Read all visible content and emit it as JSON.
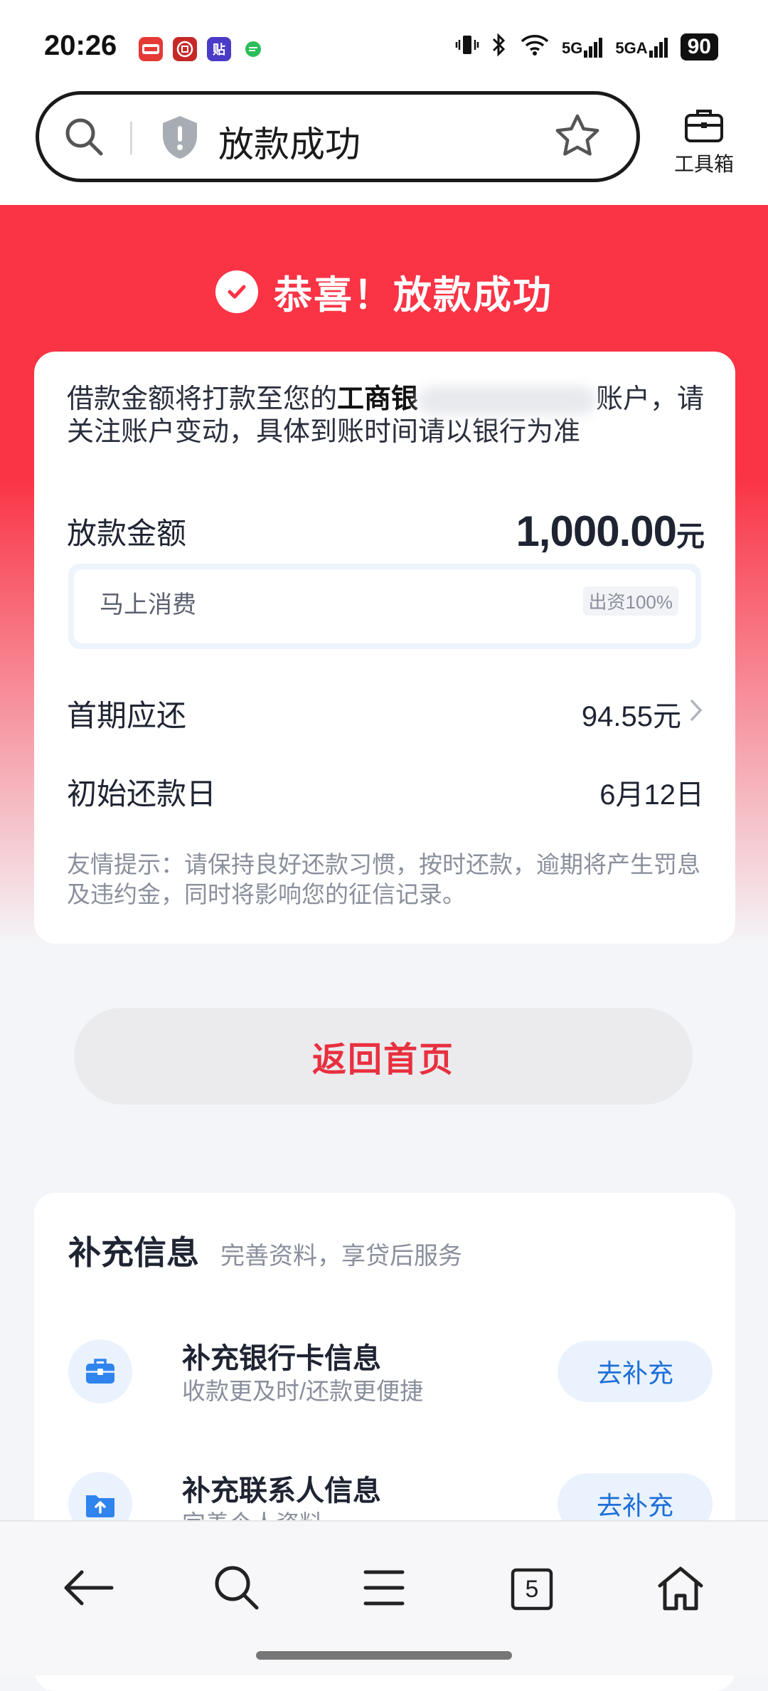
{
  "status_bar": {
    "time": "20:26",
    "app_icons": [
      {
        "name": "shopping-app-icon",
        "color": "#e53935"
      },
      {
        "name": "bank-app-icon",
        "color": "#c62828"
      },
      {
        "name": "tieba-app-icon",
        "color": "#4a3bc7",
        "text": "贴"
      },
      {
        "name": "chat-app-icon",
        "color": "#2bbd5b"
      }
    ],
    "signal_1": "5G",
    "signal_2": "5GA",
    "battery": "90"
  },
  "browser": {
    "page_title": "放款成功",
    "toolbox_label": "工具箱"
  },
  "hero": {
    "title": "恭喜！放款成功"
  },
  "card": {
    "notice_before": "借款金额将打款至您的",
    "notice_bank": "工商银",
    "notice_after": "账户，请关注账户变动，具体到账时间请以银行为准",
    "amount_label": "放款金额",
    "amount_value": "1,000.00",
    "amount_unit": "元",
    "lender_name": "马上消费",
    "lender_ratio": "出资100%",
    "first_payment_label": "首期应还",
    "first_payment_value": "94.55元",
    "start_date_label": "初始还款日",
    "start_date_value": "6月12日",
    "tip": "友情提示：请保持良好还款习惯，按时还款，逾期将产生罚息及违约金，同时将影响您的征信记录。"
  },
  "return_button": "返回首页",
  "supplement": {
    "title": "补充信息",
    "subtitle": "完善资料，享贷后服务",
    "items": [
      {
        "title": "补充银行卡信息",
        "subtitle": "收款更及时/还款更便捷",
        "button": "去补充"
      },
      {
        "title": "补充联系人信息",
        "subtitle": "完善个人资料",
        "button": "去补充"
      }
    ]
  },
  "bottom_nav": {
    "tabs_count": "5"
  },
  "colors": {
    "brand_red": "#fa3345",
    "accent_blue": "#1c6fd8"
  }
}
